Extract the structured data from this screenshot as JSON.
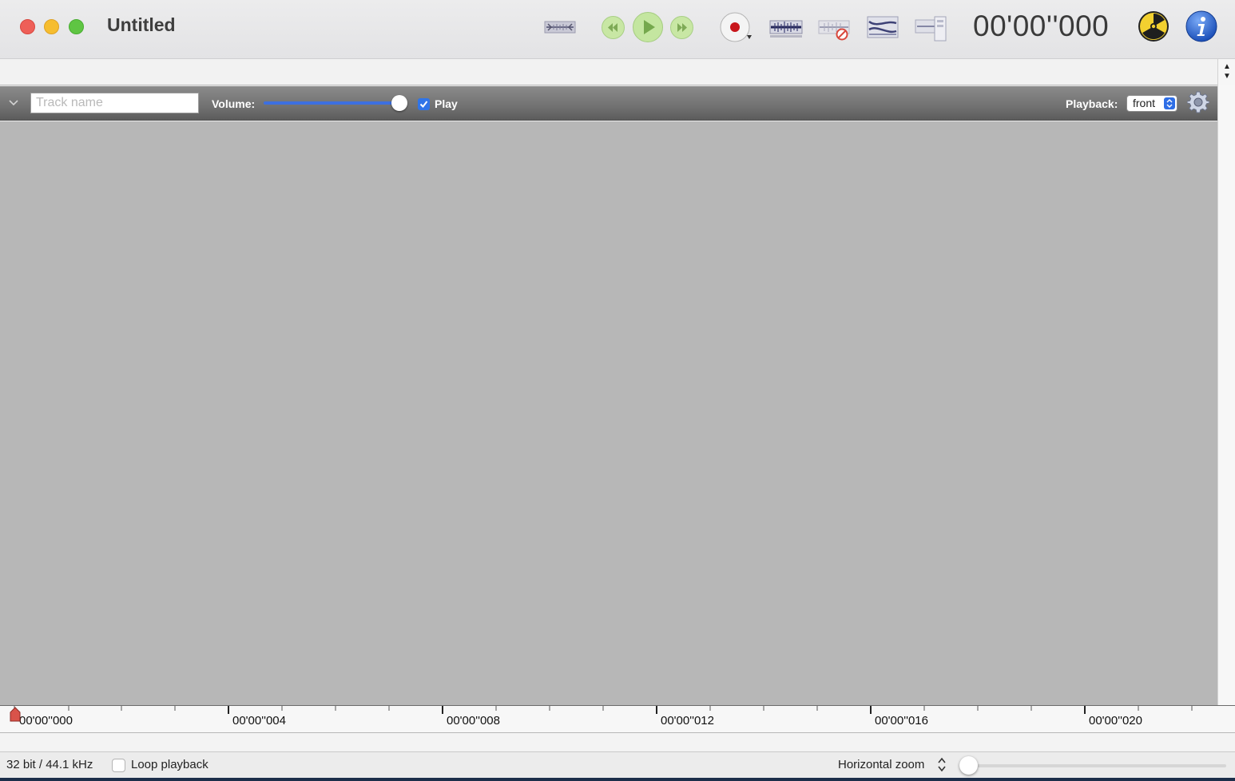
{
  "window": {
    "title": "Untitled"
  },
  "toolbar": {
    "buttons": [
      {
        "name": "trim-icon"
      },
      {
        "name": "rewind-icon"
      },
      {
        "name": "play-icon"
      },
      {
        "name": "fast-forward-icon"
      },
      {
        "name": "record-icon"
      },
      {
        "name": "waveform-icon"
      },
      {
        "name": "waveform-disabled-icon"
      },
      {
        "name": "equalizer-icon"
      },
      {
        "name": "export-icon"
      },
      {
        "name": "radiation-icon"
      },
      {
        "name": "info-icon"
      }
    ],
    "timer": "00'00''000"
  },
  "track": {
    "name_value": "",
    "name_placeholder": "Track name",
    "volume_label": "Volume:",
    "volume_level": 1.0,
    "play_label": "Play",
    "play_checked": true,
    "playback_label": "Playback:",
    "playback_value": "front"
  },
  "ruler": {
    "labels": [
      "00'00''000",
      "00'00''004",
      "00'00''008",
      "00'00''012",
      "00'00''016",
      "00'00''020"
    ]
  },
  "status": {
    "format": "32 bit / 44.1 kHz",
    "loop_label": "Loop playback",
    "loop_checked": false,
    "zoom_label": "Horizontal zoom",
    "zoom_level": 0.0
  },
  "colors": {
    "accent": "#2f74e8",
    "close": "#ee5f58",
    "minimize": "#f6bd2f",
    "maximize": "#5fc543",
    "record": "#c8161b"
  }
}
